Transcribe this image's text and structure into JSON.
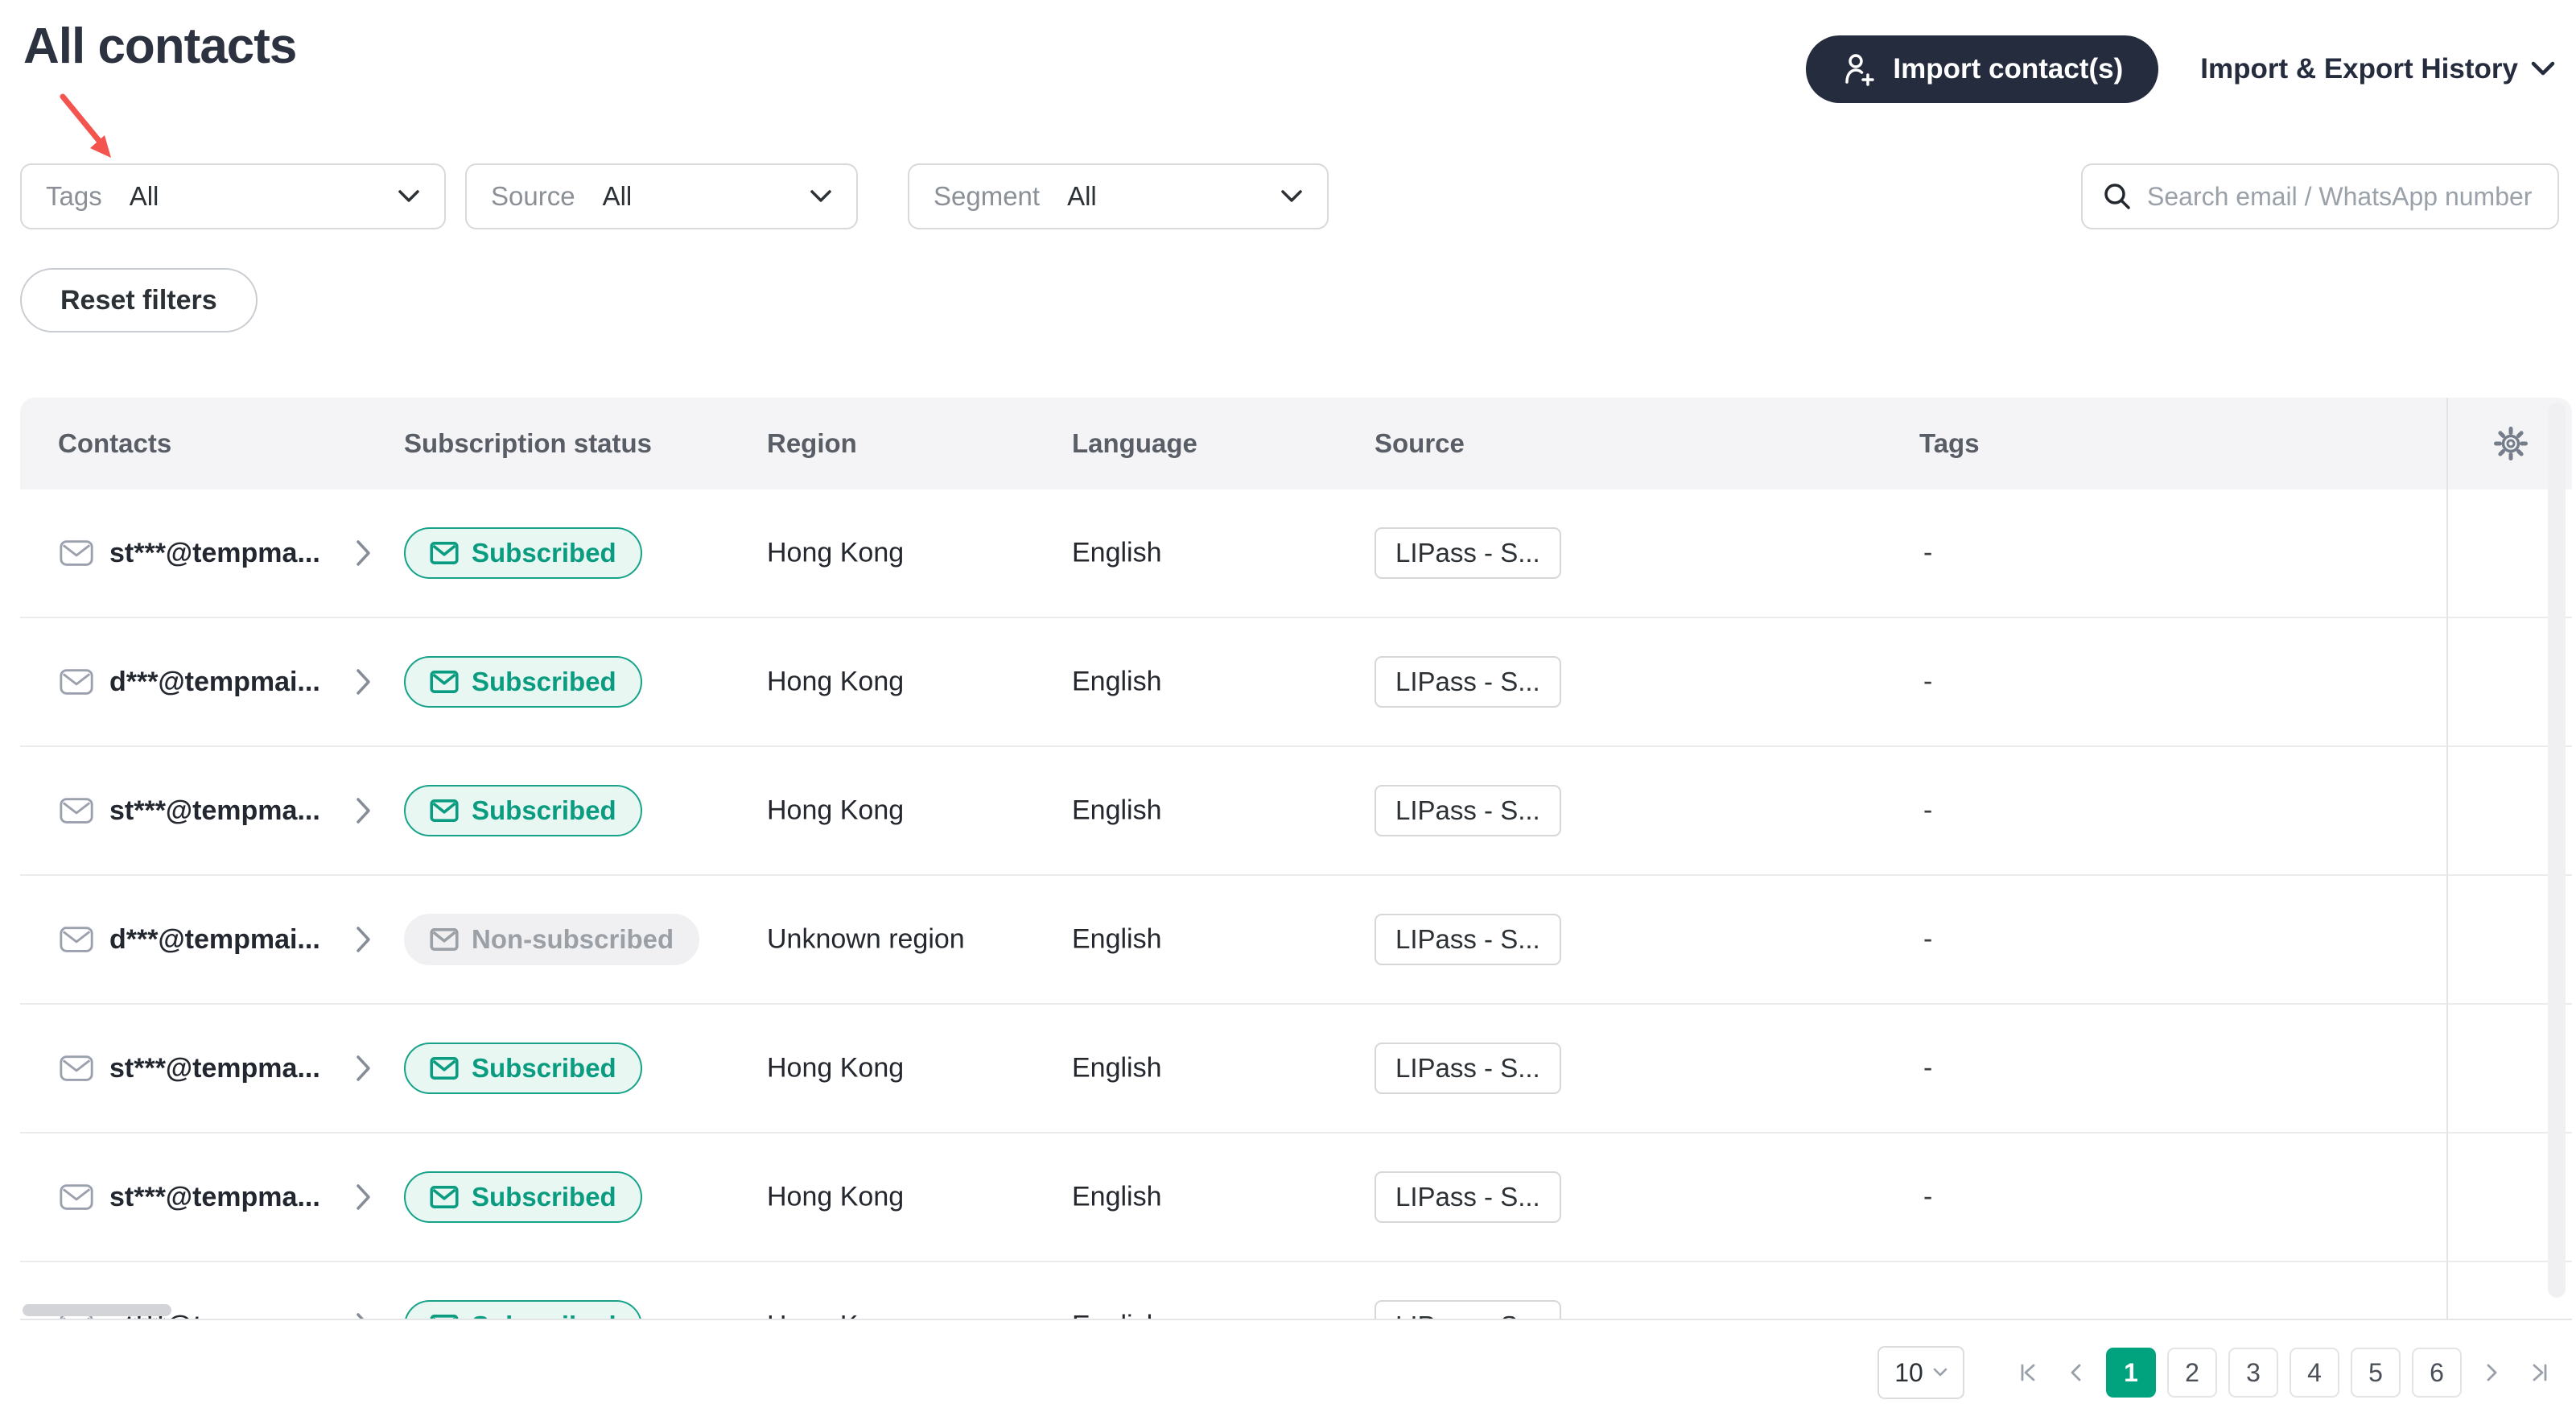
{
  "page": {
    "title": "All contacts"
  },
  "header": {
    "import_button_label": "Import contact(s)",
    "history_label": "Import & Export History"
  },
  "filters": {
    "tags": {
      "label": "Tags",
      "value": "All"
    },
    "source": {
      "label": "Source",
      "value": "All"
    },
    "segment": {
      "label": "Segment",
      "value": "All"
    },
    "search_placeholder": "Search email / WhatsApp number",
    "reset_label": "Reset filters"
  },
  "table": {
    "columns": [
      "Contacts",
      "Subscription status",
      "Region",
      "Language",
      "Source",
      "Tags"
    ],
    "rows": [
      {
        "contact": "st***@tempma...",
        "status": "Subscribed",
        "subscribed": true,
        "region": "Hong Kong",
        "language": "English",
        "source": "LIPass - S...",
        "tags": "-"
      },
      {
        "contact": "d***@tempmai...",
        "status": "Subscribed",
        "subscribed": true,
        "region": "Hong Kong",
        "language": "English",
        "source": "LIPass - S...",
        "tags": "-"
      },
      {
        "contact": "st***@tempma...",
        "status": "Subscribed",
        "subscribed": true,
        "region": "Hong Kong",
        "language": "English",
        "source": "LIPass - S...",
        "tags": "-"
      },
      {
        "contact": "d***@tempmai...",
        "status": "Non-subscribed",
        "subscribed": false,
        "region": "Unknown region",
        "language": "English",
        "source": "LIPass - S...",
        "tags": "-"
      },
      {
        "contact": "st***@tempma...",
        "status": "Subscribed",
        "subscribed": true,
        "region": "Hong Kong",
        "language": "English",
        "source": "LIPass - S...",
        "tags": "-"
      },
      {
        "contact": "st***@tempma...",
        "status": "Subscribed",
        "subscribed": true,
        "region": "Hong Kong",
        "language": "English",
        "source": "LIPass - S...",
        "tags": "-"
      },
      {
        "contact": "st***@tempma...",
        "status": "Subscribed",
        "subscribed": true,
        "region": "Hong Kong",
        "language": "English",
        "source": "LIPass - S...",
        "tags": "-"
      }
    ]
  },
  "pagination": {
    "page_size": "10",
    "pages": [
      "1",
      "2",
      "3",
      "4",
      "5",
      "6"
    ],
    "active_page": "1"
  },
  "icons": {
    "import": "person-plus-icon",
    "history": "chevron-down-icon",
    "filter": "chevron-down-icon",
    "search": "magnifier-icon",
    "contact": "envelope-icon",
    "expand": "chevron-right-icon",
    "settings": "gear-icon",
    "annotation": "red-arrow"
  },
  "colors": {
    "accent_teal": "#00a37d",
    "navy": "#252c3e",
    "subscribed_bg": "#e9f7f2",
    "subscribed_text": "#0a9c80",
    "non_subscribed_bg": "#f0f0f2",
    "non_subscribed_text": "#9aa0a6",
    "header_bg": "#f4f4f6",
    "arrow_red": "#f4544e"
  }
}
